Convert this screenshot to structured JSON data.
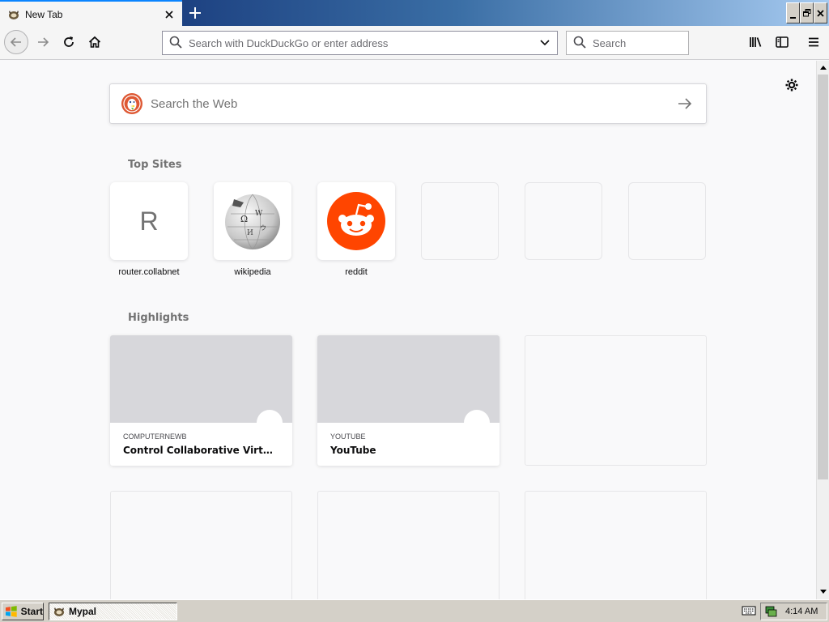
{
  "window": {
    "tab_title": "New Tab",
    "tab_icon": "mypal-icon",
    "new_tab_icon": "plus-icon"
  },
  "toolbar": {
    "url_placeholder": "Search with DuckDuckGo or enter address",
    "search_placeholder": "Search"
  },
  "newtab": {
    "websearch_placeholder": "Search the Web",
    "topsites_title": "Top Sites",
    "highlights_title": "Highlights",
    "topsites": [
      {
        "label": "router.collabnet",
        "letter": "R",
        "icon": "letter-r-icon"
      },
      {
        "label": "wikipedia",
        "icon": "wikipedia-globe-icon"
      },
      {
        "label": "reddit",
        "icon": "reddit-icon"
      },
      {
        "label": ""
      },
      {
        "label": ""
      },
      {
        "label": ""
      }
    ],
    "highlights": [
      {
        "host": "COMPUTERNEWB",
        "title": "Control Collaborative Virtual Ma..."
      },
      {
        "host": "YOUTUBE",
        "title": "YouTube"
      }
    ]
  },
  "taskbar": {
    "start_label": "Start",
    "task_label": "Mypal",
    "clock": "4:14 AM"
  },
  "colors": {
    "reddit": "#ff4500",
    "duckduckgo": "#de5833",
    "accent": "#0a84ff"
  }
}
